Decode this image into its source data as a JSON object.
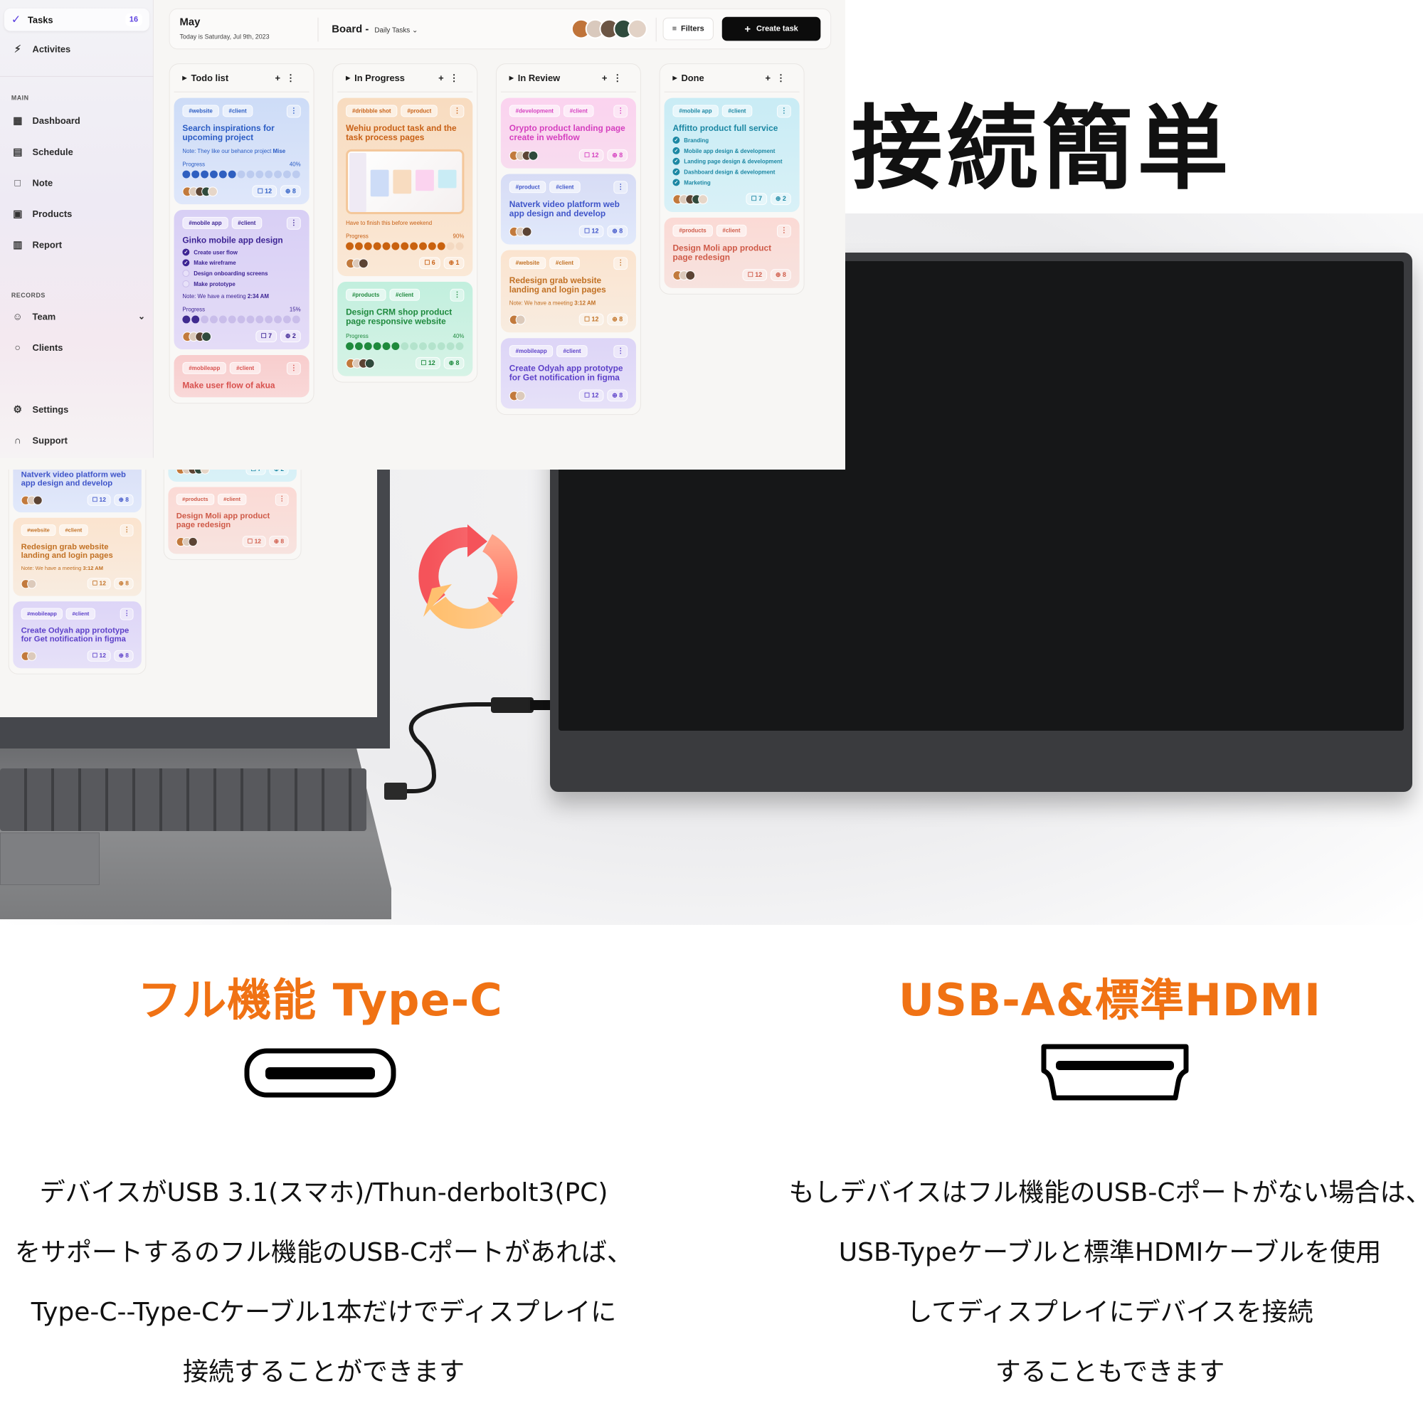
{
  "headline": "ディスプレイと接続簡単",
  "app": {
    "sidebar": {
      "tasks_label": "Tasks",
      "tasks_count": "16",
      "activities_label": "Activites",
      "main_section": "MAIN",
      "main_items": [
        {
          "label": "Dashboard",
          "icon": "dashboard-icon"
        },
        {
          "label": "Schedule",
          "icon": "calendar-icon"
        },
        {
          "label": "Note",
          "icon": "note-icon"
        },
        {
          "label": "Products",
          "icon": "products-icon"
        },
        {
          "label": "Report",
          "icon": "report-icon"
        }
      ],
      "records_section": "RECORDS",
      "records_items": [
        {
          "label": "Team",
          "icon": "team-icon"
        },
        {
          "label": "Clients",
          "icon": "clients-icon"
        }
      ],
      "bottom_items": [
        {
          "label": "Settings",
          "icon": "settings-icon"
        },
        {
          "label": "Support",
          "icon": "support-icon"
        }
      ]
    },
    "header": {
      "month": "May",
      "today": "Today is Saturday, Jul 9th, 2023",
      "board": "Board",
      "board_sep": "-",
      "board_view": "Daily Tasks",
      "filters_label": "Filters",
      "create_label": "Create task"
    },
    "columns": [
      {
        "title": "Todo list",
        "cards": [
          {
            "theme": "blue",
            "tags": [
              "#website",
              "#client"
            ],
            "title": "Search inspirations for upcoming project",
            "note": "Note:  They like our behance project",
            "note_bold": "Mise",
            "progress_label": "Progress",
            "progress": 40,
            "avatars": 5,
            "comments": "12",
            "attachments": "8"
          },
          {
            "theme": "violet",
            "tags": [
              "#mobile app",
              "#client"
            ],
            "title": "Ginko mobile app design",
            "checklist": [
              {
                "label": "Create user flow",
                "done": true
              },
              {
                "label": "Make wireframe",
                "done": true
              },
              {
                "label": "Design onboarding screens",
                "done": false
              },
              {
                "label": "Make prototype",
                "done": false
              }
            ],
            "note": "Note:  We have a meeting",
            "note_bold": "2:34 AM",
            "progress_label": "Progress",
            "progress": 15,
            "avatars": 4,
            "comments": "7",
            "attachments": "2"
          },
          {
            "theme": "red",
            "tags": [
              "#mobileapp",
              "#client"
            ],
            "title": "Make user flow of akua"
          }
        ]
      },
      {
        "title": "In Progress",
        "cards": [
          {
            "theme": "orange",
            "tags": [
              "#dribbble shot",
              "#product"
            ],
            "title": "Wehiu product task and the task process pages",
            "thumbnail": true,
            "note": "Have to finish this before weekend",
            "progress_label": "Progress",
            "progress": 90,
            "avatars": 3,
            "comments": "6",
            "attachments": "1"
          },
          {
            "theme": "green",
            "tags": [
              "#products",
              "#client"
            ],
            "title": "Design CRM shop product page responsive website",
            "progress_label": "Progress",
            "progress": 40,
            "avatars": 4,
            "comments": "12",
            "attachments": "8"
          }
        ]
      },
      {
        "title": "In Review",
        "cards": [
          {
            "theme": "pink",
            "tags": [
              "#development",
              "#client"
            ],
            "title": "Orypto product landing  page create in webflow",
            "avatars": 4,
            "comments": "12",
            "attachments": "8"
          },
          {
            "theme": "indigo",
            "tags": [
              "#product",
              "#client"
            ],
            "title": "Natverk video platform web app design and develop",
            "avatars": 3,
            "comments": "12",
            "attachments": "8"
          },
          {
            "theme": "peach",
            "tags": [
              "#website",
              "#client"
            ],
            "title": "Redesign grab website landing and login pages",
            "note": "Note:  We have a meeting",
            "note_bold": "3:12 AM",
            "avatars": 2,
            "comments": "12",
            "attachments": "8"
          },
          {
            "theme": "lilac",
            "tags": [
              "#mobileapp",
              "#client"
            ],
            "title": "Create Odyah app prototype for Get notification in figma",
            "avatars": 2,
            "comments": "12",
            "attachments": "8"
          }
        ]
      },
      {
        "title": "Done",
        "cards": [
          {
            "theme": "cyan",
            "tags": [
              "#mobile app",
              "#client"
            ],
            "title": "Affitto product full service",
            "checklist": [
              {
                "label": "Branding",
                "done": true
              },
              {
                "label": "Mobile app design & development",
                "done": true
              },
              {
                "label": "Landing page design & development",
                "done": true
              },
              {
                "label": "Dashboard design & development",
                "done": true
              },
              {
                "label": "Marketing",
                "done": true
              }
            ],
            "avatars": 5,
            "comments": "7",
            "attachments": "2"
          },
          {
            "theme": "salmon",
            "tags": [
              "#products",
              "#client"
            ],
            "title": "Design Moli app product page redesign",
            "avatars": 3,
            "comments": "12",
            "attachments": "8"
          }
        ]
      }
    ]
  },
  "themes": {
    "blue": {
      "bg": "#cddcf7",
      "bg2": "#dfe7fa",
      "fg": "#2b5cc4",
      "dot": "#2f5fc0",
      "dot_off": "#bccbef"
    },
    "violet": {
      "bg": "#d8cff5",
      "bg2": "#e4dcf7",
      "fg": "#3d2494",
      "dot": "#3f2a8f",
      "dot_off": "#c9bdea",
      "check": "#3d2494"
    },
    "red": {
      "bg": "#f8cdcd",
      "bg2": "#f9d8d8",
      "fg": "#d8504d"
    },
    "orange": {
      "bg": "#f8dcc0",
      "bg2": "#fae8d6",
      "fg": "#c86116",
      "dot": "#c9620f",
      "dot_off": "#f4d9c1"
    },
    "green": {
      "bg": "#c2efde",
      "bg2": "#d6f3e6",
      "fg": "#1f8a3e",
      "dot": "#1e8a3c",
      "dot_off": "#b3e3cc"
    },
    "pink": {
      "bg": "#fbd3ef",
      "bg2": "#f8dcef",
      "fg": "#d53fbf"
    },
    "indigo": {
      "bg": "#d7dcf5",
      "bg2": "#e1e9fb",
      "fg": "#3f55c9"
    },
    "peach": {
      "bg": "#fbe4cf",
      "bg2": "#f8ece0",
      "fg": "#c27124"
    },
    "lilac": {
      "bg": "#ddd5f7",
      "bg2": "#e6e1f8",
      "fg": "#5d41c9"
    },
    "cyan": {
      "bg": "#c9ecf5",
      "bg2": "#d9f1f7",
      "fg": "#1b87a3",
      "check": "#1b87a3"
    },
    "salmon": {
      "bg": "#fbdad5",
      "bg2": "#f7e3df",
      "fg": "#cf5a48"
    }
  },
  "features": {
    "left": {
      "title": "フル機能 Type-C",
      "icon": "usb-c-port-icon",
      "lines": [
        "デバイスがUSB 3.1(スマホ)/Thun-derbolt3(PC)",
        "をサポートするのフル機能のUSB-Cポートがあれば、",
        "Type-C--Type-Cケーブル1本だけでディスプレイに",
        "接続することができます"
      ]
    },
    "right": {
      "title": "USB-A&標準HDMI",
      "icon": "hdmi-port-icon",
      "lines": [
        "もしデバイスはフル機能のUSB-Cポートがない場合は、",
        "USB-Typeケーブルと標準HDMIケーブルを使用",
        "してディスプレイにデバイスを接続",
        "することもできます"
      ]
    },
    "accent": "#f07214"
  }
}
